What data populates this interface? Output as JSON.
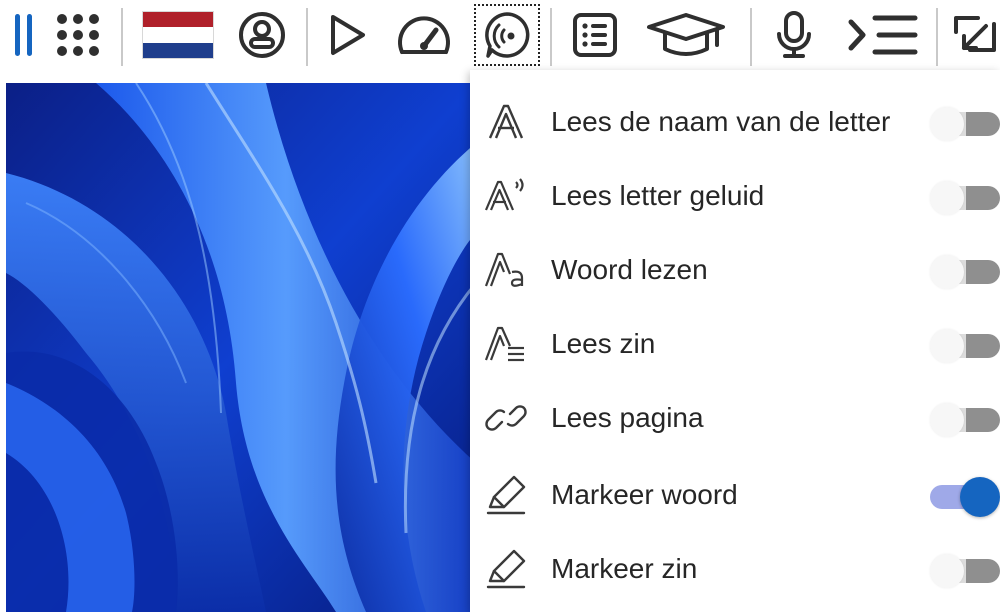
{
  "toolbar": {
    "items": [
      {
        "name": "pause-icon"
      },
      {
        "name": "apps-grid-icon"
      },
      {
        "name": "dutch-flag-icon"
      },
      {
        "name": "user-profile-icon"
      },
      {
        "name": "play-icon"
      },
      {
        "name": "speed-gauge-icon"
      },
      {
        "name": "speech-settings-icon"
      },
      {
        "name": "checklist-icon"
      },
      {
        "name": "graduation-cap-icon"
      },
      {
        "name": "microphone-icon"
      },
      {
        "name": "indent-list-icon"
      },
      {
        "name": "screen-capture-icon"
      }
    ],
    "accent_color": "#1565c0",
    "icon_color": "#2f2f2f"
  },
  "menu": {
    "items": [
      {
        "label": "Lees de naam van de letter",
        "icon": "letter-a-icon",
        "enabled": false
      },
      {
        "label": "Lees letter geluid",
        "icon": "letter-sound-icon",
        "enabled": false
      },
      {
        "label": "Woord lezen",
        "icon": "word-read-icon",
        "enabled": false
      },
      {
        "label": "Lees zin",
        "icon": "sentence-read-icon",
        "enabled": false
      },
      {
        "label": "Lees pagina",
        "icon": "link-icon",
        "enabled": false
      },
      {
        "label": "Markeer woord",
        "icon": "highlighter-icon",
        "enabled": true
      },
      {
        "label": "Markeer zin",
        "icon": "highlighter-icon",
        "enabled": false
      }
    ],
    "toggle_on_color": "#1565c0"
  }
}
